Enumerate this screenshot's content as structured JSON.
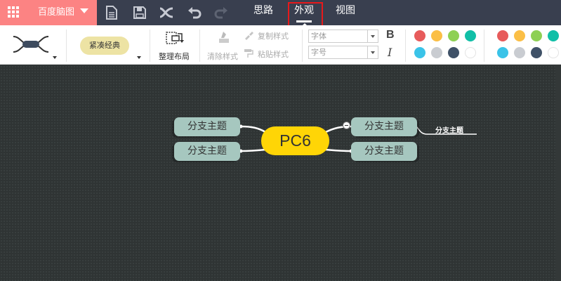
{
  "app": {
    "name": "百度脑图"
  },
  "topbar": {
    "tabs": [
      {
        "label": "思路"
      },
      {
        "label": "外观"
      },
      {
        "label": "视图"
      }
    ],
    "active_tab": "外观"
  },
  "toolbar": {
    "theme_label": "紧凑经典",
    "arrange_label": "整理布局",
    "clear_style_label": "清除样式",
    "copy_style_label": "复制样式",
    "paste_style_label": "粘贴样式",
    "font_family_placeholder": "字体",
    "font_size_placeholder": "字号",
    "bold_label": "B",
    "italic_label": "I",
    "font_colors": [
      "#e75b5b",
      "#fbbf46",
      "#8ed054",
      "#11bfa7",
      "#3ac3e8",
      "#c9ccd1",
      "#3f5167",
      "#ffffff"
    ],
    "bg_colors": [
      "#e75b5b",
      "#fbbf46",
      "#8ed054",
      "#11bfa7",
      "#3ac3e8",
      "#c9ccd1",
      "#3f5167",
      "#ffffff"
    ]
  },
  "mindmap": {
    "root": "PC6",
    "branches": [
      {
        "label": "分支主题"
      },
      {
        "label": "分支主题"
      },
      {
        "label": "分支主题"
      },
      {
        "label": "分支主题"
      }
    ],
    "sub_topic": "分支主题"
  },
  "colors": {
    "accent": "#fc8383",
    "topbar_bg": "#393f4f",
    "highlight": "#e8191b",
    "root_fill": "#ffd506",
    "branch_fill": "#a6c7bf",
    "canvas_bg": "#2f3434"
  }
}
